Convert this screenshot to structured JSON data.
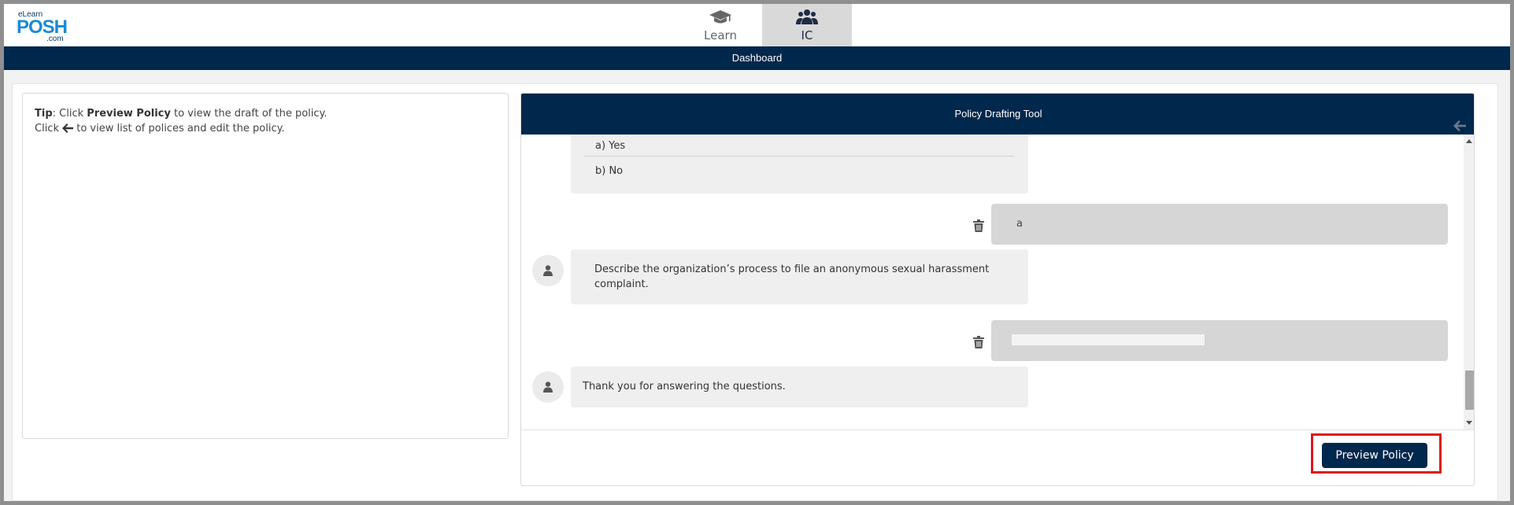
{
  "header": {
    "logo": {
      "line1": "eLearn",
      "line2": "POSH",
      "line3": ".com"
    },
    "nav": [
      {
        "label": "Learn",
        "icon": "graduation-cap-icon"
      },
      {
        "label": "IC",
        "icon": "users-icon",
        "active": true
      }
    ]
  },
  "dashbar": {
    "title": "Dashboard"
  },
  "tip": {
    "label": "Tip",
    "line1_pre": ": Click ",
    "line1_bold": "Preview Policy",
    "line1_post": " to view the draft of the policy.",
    "line2_pre": "Click ",
    "line2_icon": "arrow-left-icon",
    "line2_post": " to view list of polices and edit the policy."
  },
  "tool": {
    "title": "Policy Drafting Tool",
    "options": [
      "a) Yes",
      "b) No"
    ],
    "messages": [
      {
        "from": "user",
        "text": "a"
      },
      {
        "from": "bot",
        "text": "Describe the organization’s process to file an anonymous sexual harassment complaint."
      },
      {
        "from": "user",
        "text": ""
      },
      {
        "from": "bot",
        "text": "Thank you for answering the questions."
      }
    ],
    "preview_label": "Preview Policy"
  },
  "colors": {
    "navy": "#00274c",
    "highlight": "#e0161a",
    "bubble_bot": "#efefef",
    "bubble_user": "#d6d6d6"
  }
}
